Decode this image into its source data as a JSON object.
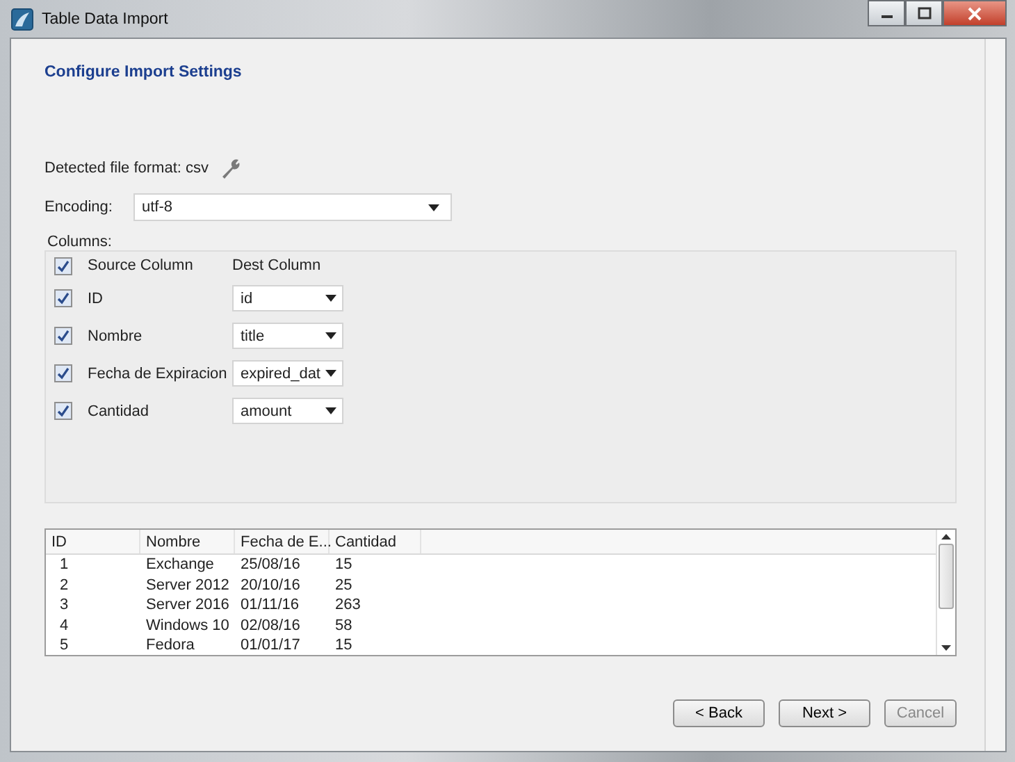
{
  "window": {
    "title": "Table Data Import"
  },
  "heading": "Configure Import Settings",
  "detected_format": "Detected file format: csv",
  "encoding": {
    "label": "Encoding:",
    "value": "utf-8"
  },
  "columns_group": {
    "label": "Columns:",
    "header": {
      "checked": true,
      "source": "Source Column",
      "dest": "Dest Column"
    },
    "rows": [
      {
        "checked": true,
        "source": "ID",
        "dest": "id"
      },
      {
        "checked": true,
        "source": "Nombre",
        "dest": "title"
      },
      {
        "checked": true,
        "source": "Fecha de Expiracion",
        "dest": "expired_dat"
      },
      {
        "checked": true,
        "source": "Cantidad",
        "dest": "amount"
      }
    ]
  },
  "preview": {
    "columns": [
      "ID",
      "Nombre",
      "Fecha de E...",
      "Cantidad"
    ],
    "rows": [
      [
        "1",
        "Exchange",
        "25/08/16",
        "15"
      ],
      [
        "2",
        "Server 2012",
        "20/10/16",
        "25"
      ],
      [
        "3",
        "Server 2016",
        "01/11/16",
        "263"
      ],
      [
        "4",
        "Windows 10",
        "02/08/16",
        "58"
      ],
      [
        "5",
        "Fedora",
        "01/01/17",
        "15"
      ]
    ]
  },
  "buttons": [
    "< Back",
    "Next >",
    "Cancel"
  ]
}
